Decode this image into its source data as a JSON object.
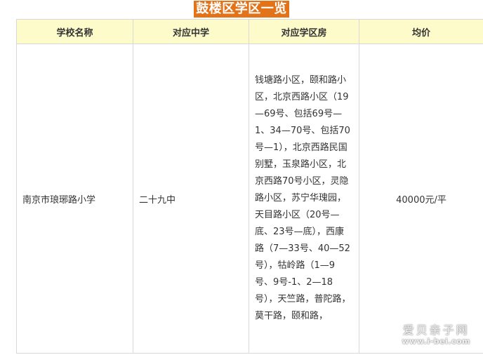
{
  "title": "鼓楼区学区一览",
  "table": {
    "headers": [
      "学校名称",
      "对应中学",
      "对应学区房",
      "均价"
    ],
    "rows": [
      {
        "school": "南京市琅琊路小学",
        "middle_school": "二十九中",
        "housing": "钱塘路小区，颐和路小区，北京西路小区（19—69号、包括69号—1、34—70号、包括70号—1），北京西路民国别墅，玉泉路小区，北京西路70号小区，灵隐路小区，苏宁华瑰园，天目路小区（20号—底、23号—底），西康路（7—33号、40—52号），牯岭路（1—9号、9号-1、2—18号），天竺路，普陀路，莫干路，颐和路，",
        "price": "40000元/平"
      }
    ]
  },
  "watermark": {
    "cn": "爱贝亲子网",
    "url": "www.i-bei.com"
  }
}
